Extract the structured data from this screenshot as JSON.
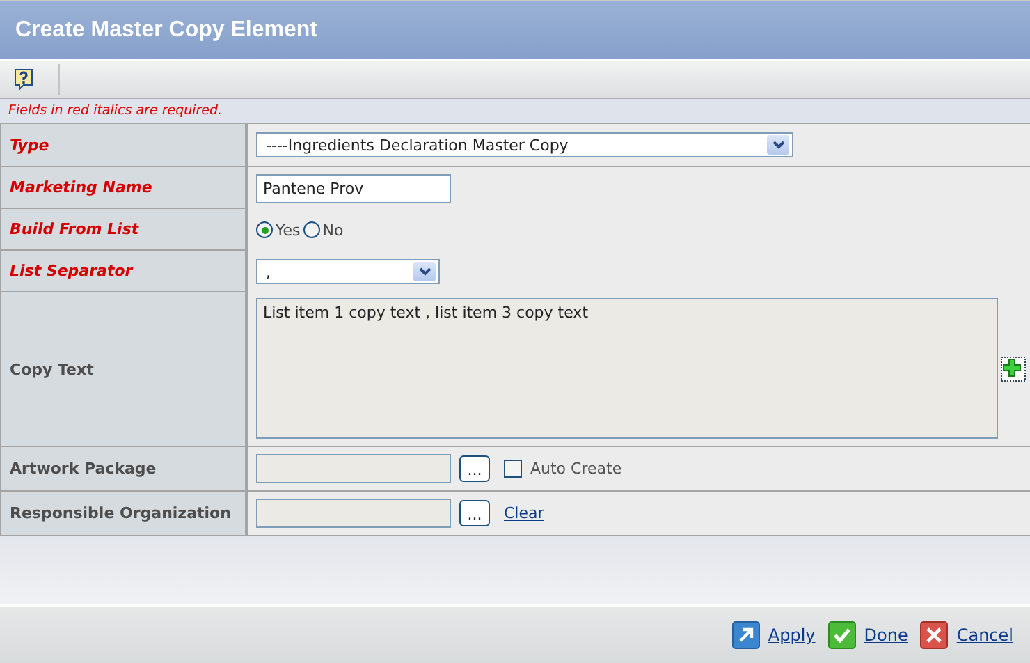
{
  "window": {
    "title": "Create Master Copy Element"
  },
  "note": "Fields in red italics are required.",
  "fields": [
    {
      "label": "Type",
      "required": true,
      "kind": "dropdown",
      "value": "----Ingredients Declaration Master Copy"
    },
    {
      "label": "Marketing Name",
      "required": true,
      "kind": "text",
      "value": "Pantene Prov"
    },
    {
      "label": "Build From List",
      "required": true,
      "kind": "radio",
      "options": [
        {
          "label": "Yes",
          "selected": true
        },
        {
          "label": "No",
          "selected": false
        }
      ]
    },
    {
      "label": "List Separator",
      "required": true,
      "kind": "minidropdown",
      "value": ","
    },
    {
      "label": "Copy Text",
      "required": false,
      "kind": "textarea",
      "value": "List item 1 copy text , list item 3 copy text"
    },
    {
      "label": "Artwork Package",
      "required": false,
      "kind": "chooser",
      "button": "...",
      "checkbox": {
        "label": "Auto Create",
        "checked": false
      }
    },
    {
      "label": "Responsible Organization",
      "required": false,
      "kind": "chooser",
      "button": "...",
      "link": "Clear"
    }
  ],
  "actions": [
    {
      "label": "Apply",
      "kind": "apply"
    },
    {
      "label": "Done",
      "kind": "done"
    },
    {
      "label": "Cancel",
      "kind": "cancel"
    }
  ]
}
